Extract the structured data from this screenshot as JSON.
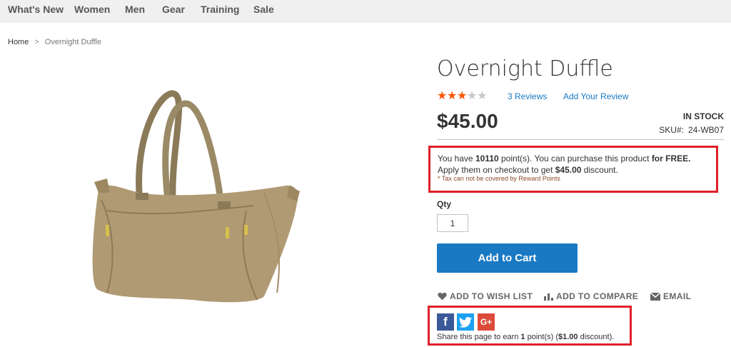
{
  "nav": {
    "items": [
      "What's New",
      "Women",
      "Men",
      "Gear",
      "Training",
      "Sale"
    ]
  },
  "breadcrumb": {
    "home": "Home",
    "separator": ">",
    "current": "Overnight Duffle"
  },
  "product": {
    "title": "Overnight Duffle",
    "rating": {
      "filled": 3,
      "total": 5
    },
    "reviews_label": "3 Reviews",
    "add_review_label": "Add Your Review",
    "price": "$45.00",
    "stock": "IN STOCK",
    "sku_label": "SKU#:",
    "sku_value": "24-WB07",
    "image_icon": "duffle-bag-image"
  },
  "reward": {
    "text_1": "You have ",
    "points": "10110",
    "text_2": " point(s). You can purchase this product ",
    "free": "for FREE.",
    "text_3": " Apply them on checkout to get ",
    "discount": "$45.00",
    "text_4": " discount.",
    "note": "* Tax can not be covered by Reward Points"
  },
  "purchase": {
    "qty_label": "Qty",
    "qty_value": "1",
    "add_to_cart": "Add to Cart"
  },
  "actions": {
    "wishlist": "ADD TO WISH LIST",
    "compare": "ADD TO COMPARE",
    "email": "EMAIL"
  },
  "share": {
    "text_1": "Share this page to earn ",
    "points": "1",
    "text_2": " point(s) (",
    "discount": "$1.00",
    "text_3": " discount).",
    "networks": [
      "facebook-icon",
      "twitter-icon",
      "google-plus-icon"
    ]
  },
  "colors": {
    "accent": "#1979c3",
    "highlight_border": "#e0202a",
    "star_filled": "#ff5501",
    "star_empty": "#c7c7c7"
  }
}
